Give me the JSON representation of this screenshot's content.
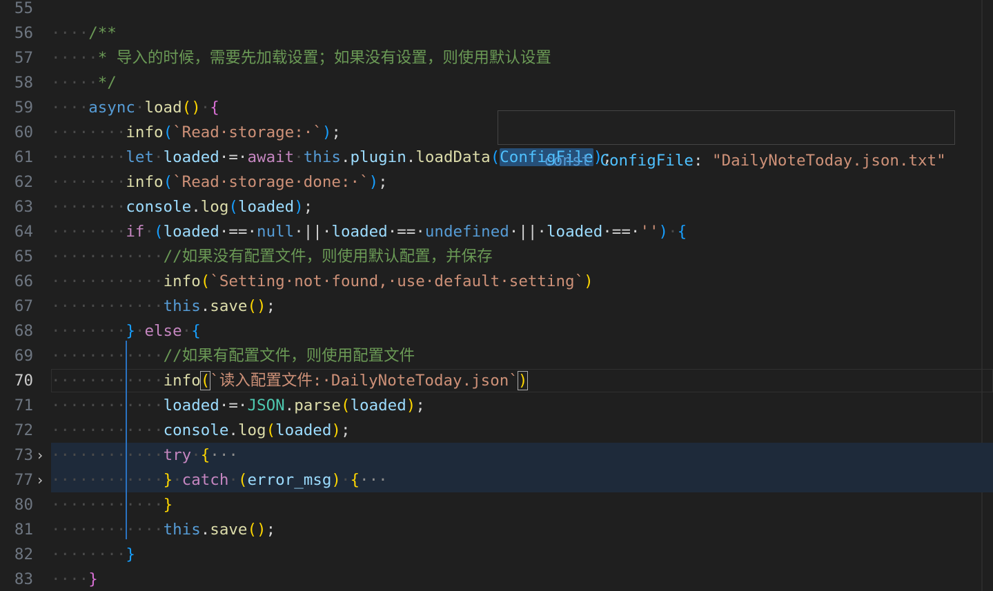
{
  "editor": {
    "active_line": "70",
    "lines": [
      {
        "num": "55",
        "indent": "",
        "tokens": []
      },
      {
        "num": "56",
        "indent": "····",
        "tokens": [
          {
            "t": "/**",
            "c": "cm"
          }
        ]
      },
      {
        "num": "57",
        "indent": "·····",
        "tokens": [
          {
            "t": "* 导入的时候，需要先加载设置；如果没有设置，则使用默认设置",
            "c": "cm"
          }
        ]
      },
      {
        "num": "58",
        "indent": "·····",
        "tokens": [
          {
            "t": "*/",
            "c": "cm"
          }
        ]
      },
      {
        "num": "59",
        "indent": "····",
        "tokens": [
          {
            "t": "async",
            "c": "kw"
          },
          {
            "t": "·",
            "c": "ws"
          },
          {
            "t": "load",
            "c": "fn"
          },
          {
            "t": "()",
            "c": "b1"
          },
          {
            "t": "·",
            "c": "ws"
          },
          {
            "t": "{",
            "c": "b2"
          }
        ]
      },
      {
        "num": "60",
        "indent": "········",
        "tokens": [
          {
            "t": "info",
            "c": "fn"
          },
          {
            "t": "(",
            "c": "b3"
          },
          {
            "t": "`Read·storage:·`",
            "c": "str"
          },
          {
            "t": ")",
            "c": "b3"
          },
          {
            "t": ";",
            "c": "pn"
          }
        ]
      },
      {
        "num": "61",
        "indent": "········",
        "tokens": [
          {
            "t": "let",
            "c": "kw"
          },
          {
            "t": "·",
            "c": "ws"
          },
          {
            "t": "loaded",
            "c": "var"
          },
          {
            "t": "·=·",
            "c": "pn"
          },
          {
            "t": "await",
            "c": "ctl"
          },
          {
            "t": "·",
            "c": "ws"
          },
          {
            "t": "this",
            "c": "kw"
          },
          {
            "t": ".",
            "c": "pn"
          },
          {
            "t": "plugin",
            "c": "var"
          },
          {
            "t": ".",
            "c": "pn"
          },
          {
            "t": "loadData",
            "c": "fn"
          },
          {
            "t": "(",
            "c": "b3"
          },
          {
            "t": "ConfigFile",
            "c": "cst sel"
          },
          {
            "t": ")",
            "c": "b3"
          },
          {
            "t": ";",
            "c": "pn"
          }
        ]
      },
      {
        "num": "62",
        "indent": "········",
        "tokens": [
          {
            "t": "info",
            "c": "fn"
          },
          {
            "t": "(",
            "c": "b3"
          },
          {
            "t": "`Read·storage·done:·`",
            "c": "str"
          },
          {
            "t": ")",
            "c": "b3"
          },
          {
            "t": ";",
            "c": "pn"
          }
        ]
      },
      {
        "num": "63",
        "indent": "········",
        "tokens": [
          {
            "t": "console",
            "c": "var"
          },
          {
            "t": ".",
            "c": "pn"
          },
          {
            "t": "log",
            "c": "fn"
          },
          {
            "t": "(",
            "c": "b3"
          },
          {
            "t": "loaded",
            "c": "var"
          },
          {
            "t": ")",
            "c": "b3"
          },
          {
            "t": ";",
            "c": "pn"
          }
        ]
      },
      {
        "num": "64",
        "indent": "········",
        "tokens": [
          {
            "t": "if",
            "c": "ctl"
          },
          {
            "t": "·",
            "c": "ws"
          },
          {
            "t": "(",
            "c": "b3"
          },
          {
            "t": "loaded",
            "c": "var"
          },
          {
            "t": "·==·",
            "c": "pn"
          },
          {
            "t": "null",
            "c": "kw"
          },
          {
            "t": "·||·",
            "c": "pn"
          },
          {
            "t": "loaded",
            "c": "var"
          },
          {
            "t": "·==·",
            "c": "pn"
          },
          {
            "t": "undefined",
            "c": "kw"
          },
          {
            "t": "·||·",
            "c": "pn"
          },
          {
            "t": "loaded",
            "c": "var"
          },
          {
            "t": "·==·",
            "c": "pn"
          },
          {
            "t": "''",
            "c": "str"
          },
          {
            "t": ")",
            "c": "b3"
          },
          {
            "t": "·",
            "c": "ws"
          },
          {
            "t": "{",
            "c": "b3"
          }
        ]
      },
      {
        "num": "65",
        "indent": "············",
        "tokens": [
          {
            "t": "//如果没有配置文件，则使用默认配置，并保存",
            "c": "cm"
          }
        ]
      },
      {
        "num": "66",
        "indent": "············",
        "tokens": [
          {
            "t": "info",
            "c": "fn"
          },
          {
            "t": "(",
            "c": "b1"
          },
          {
            "t": "`Setting·not·found,·use·default·setting`",
            "c": "str"
          },
          {
            "t": ")",
            "c": "b1"
          }
        ]
      },
      {
        "num": "67",
        "indent": "············",
        "tokens": [
          {
            "t": "this",
            "c": "kw"
          },
          {
            "t": ".",
            "c": "pn"
          },
          {
            "t": "save",
            "c": "fn"
          },
          {
            "t": "()",
            "c": "b1"
          },
          {
            "t": ";",
            "c": "pn"
          }
        ]
      },
      {
        "num": "68",
        "indent": "········",
        "tokens": [
          {
            "t": "}",
            "c": "b3"
          },
          {
            "t": "·",
            "c": "ws"
          },
          {
            "t": "else",
            "c": "ctl"
          },
          {
            "t": "·",
            "c": "ws"
          },
          {
            "t": "{",
            "c": "b3"
          }
        ]
      },
      {
        "num": "69",
        "indent": "············",
        "tokens": [
          {
            "t": "//如果有配置文件，则使用配置文件",
            "c": "cm"
          }
        ]
      },
      {
        "num": "70",
        "indent": "············",
        "tokens": [
          {
            "t": "info",
            "c": "fn"
          },
          {
            "t": "(",
            "c": "b1 bm"
          },
          {
            "t": "`读入配置文件:·DailyNoteToday.json`",
            "c": "str"
          },
          {
            "t": ")",
            "c": "b1 bm"
          }
        ]
      },
      {
        "num": "71",
        "indent": "············",
        "tokens": [
          {
            "t": "loaded",
            "c": "var"
          },
          {
            "t": "·=·",
            "c": "pn"
          },
          {
            "t": "JSON",
            "c": "cls"
          },
          {
            "t": ".",
            "c": "pn"
          },
          {
            "t": "parse",
            "c": "fn"
          },
          {
            "t": "(",
            "c": "b1"
          },
          {
            "t": "loaded",
            "c": "var"
          },
          {
            "t": ")",
            "c": "b1"
          },
          {
            "t": ";",
            "c": "pn"
          }
        ]
      },
      {
        "num": "72",
        "indent": "············",
        "tokens": [
          {
            "t": "console",
            "c": "var"
          },
          {
            "t": ".",
            "c": "pn"
          },
          {
            "t": "log",
            "c": "fn"
          },
          {
            "t": "(",
            "c": "b1"
          },
          {
            "t": "loaded",
            "c": "var"
          },
          {
            "t": ")",
            "c": "b1"
          },
          {
            "t": ";",
            "c": "pn"
          }
        ]
      },
      {
        "num": "73",
        "indent": "············",
        "fold": "›",
        "tokens": [
          {
            "t": "try",
            "c": "ctl"
          },
          {
            "t": "·",
            "c": "ws"
          },
          {
            "t": "{",
            "c": "b1"
          },
          {
            "t": "···",
            "c": "ellipsis"
          }
        ]
      },
      {
        "num": "77",
        "indent": "············",
        "fold": "›",
        "tokens": [
          {
            "t": "}",
            "c": "b1"
          },
          {
            "t": "·",
            "c": "ws"
          },
          {
            "t": "catch",
            "c": "ctl"
          },
          {
            "t": "·",
            "c": "ws"
          },
          {
            "t": "(",
            "c": "b1"
          },
          {
            "t": "error_msg",
            "c": "var"
          },
          {
            "t": ")",
            "c": "b1"
          },
          {
            "t": "·",
            "c": "ws"
          },
          {
            "t": "{",
            "c": "b1"
          },
          {
            "t": "···",
            "c": "ellipsis"
          }
        ]
      },
      {
        "num": "80",
        "indent": "············",
        "tokens": [
          {
            "t": "}",
            "c": "b1"
          }
        ]
      },
      {
        "num": "81",
        "indent": "············",
        "tokens": [
          {
            "t": "this",
            "c": "kw"
          },
          {
            "t": ".",
            "c": "pn"
          },
          {
            "t": "save",
            "c": "fn"
          },
          {
            "t": "()",
            "c": "b1"
          },
          {
            "t": ";",
            "c": "pn"
          }
        ]
      },
      {
        "num": "82",
        "indent": "········",
        "tokens": [
          {
            "t": "}",
            "c": "b3"
          }
        ]
      },
      {
        "num": "83",
        "indent": "····",
        "tokens": [
          {
            "t": "}",
            "c": "b2"
          }
        ]
      }
    ]
  },
  "hover": {
    "keyword": "const",
    "name": "ConfigFile",
    "sep": ":",
    "value": "\"DailyNoteToday.json.txt\"",
    "colors": {
      "keyword": "#569cd6",
      "name": "#4fc1ff",
      "value": "#ce9178"
    }
  }
}
